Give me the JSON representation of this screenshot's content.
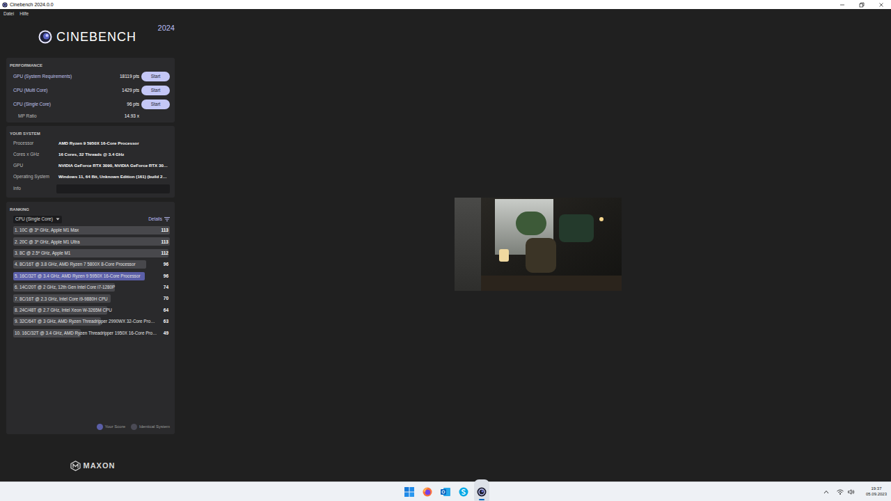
{
  "window": {
    "title": "Cinebench 2024.0.0"
  },
  "menu": [
    "Datei",
    "Hilfe"
  ],
  "logo": {
    "name": "CINEBENCH",
    "year": "2024"
  },
  "performance": {
    "title": "PERFORMANCE",
    "rows": [
      {
        "label": "GPU (System Requirements)",
        "score": "18119 pts",
        "button": "Start"
      },
      {
        "label": "CPU (Multi Core)",
        "score": "1429 pts",
        "button": "Start"
      },
      {
        "label": "CPU (Single Core)",
        "score": "96 pts",
        "button": "Start"
      }
    ],
    "mp_ratio": {
      "label": "MP Ratio",
      "value": "14.93 x"
    }
  },
  "system": {
    "title": "YOUR SYSTEM",
    "rows": [
      {
        "label": "Processor",
        "value": "AMD Ryzen 9 5950X 16-Core Processor"
      },
      {
        "label": "Cores x GHz",
        "value": "16 Cores, 32 Threads @ 3.4 GHz"
      },
      {
        "label": "GPU",
        "value": "NVIDIA GeForce RTX 3090, NVIDIA GeForce RTX 30…"
      },
      {
        "label": "Operating System",
        "value": "Windows 11, 64 Bit, Unknown Edition (161) (build 2…"
      }
    ],
    "info": {
      "label": "Info",
      "value": ""
    }
  },
  "ranking": {
    "title": "RANKING",
    "dropdown": "CPU (Single Core)",
    "details": "Details",
    "items": [
      {
        "label": "1. 10C @ 3* GHz, Apple M1 Max",
        "score": "113",
        "level": 1.0,
        "selected": false
      },
      {
        "label": "2. 20C @ 3* GHz, Apple M1 Ultra",
        "score": "113",
        "level": 1.0,
        "selected": false
      },
      {
        "label": "3. 8C @ 2.5* GHz, Apple M1",
        "score": "112",
        "level": 0.99,
        "selected": false
      },
      {
        "label": "4. 8C/16T @ 3.8 GHz, AMD Ryzen 7 5800X 8-Core Processor",
        "score": "96",
        "level": 0.85,
        "selected": false
      },
      {
        "label": "5. 16C/32T @ 3.4 GHz, AMD Ryzen 9 5950X 16-Core Processor",
        "score": "96",
        "level": 0.84,
        "selected": true
      },
      {
        "label": "6. 14C/20T @ 2 GHz, 12th Gen Intel Core i7-1280P",
        "score": "74",
        "level": 0.65,
        "selected": false
      },
      {
        "label": "7. 8C/16T @ 2.3 GHz, Intel Core i9-9880H CPU",
        "score": "70",
        "level": 0.62,
        "selected": false
      },
      {
        "label": "8. 24C/48T @ 2.7 GHz, Intel Xeon W-3265M CPU",
        "score": "64",
        "level": 0.6,
        "selected": false
      },
      {
        "label": "9. 32C/64T @ 3 GHz, AMD Ryzen Threadripper 2990WX 32-Core Pro…",
        "score": "63",
        "level": 0.56,
        "selected": false
      },
      {
        "label": "10. 16C/32T @ 3.4 GHz, AMD Ryzen Threadripper 1950X 16-Core Pro…",
        "score": "49",
        "level": 0.43,
        "selected": false
      }
    ],
    "legend": [
      {
        "label": "Your Score",
        "color": "#5b5fa8"
      },
      {
        "label": "Identical System",
        "color": "#4a4a55"
      }
    ]
  },
  "footer": {
    "brand": "MAXON"
  },
  "taskbar": {
    "apps": [
      {
        "kind": "start",
        "selected": false
      },
      {
        "kind": "firefox",
        "selected": false
      },
      {
        "kind": "outlook",
        "selected": false
      },
      {
        "kind": "skype",
        "selected": false
      },
      {
        "kind": "cinebench",
        "selected": true
      }
    ],
    "clock": {
      "time": "19:37",
      "date": "05.09.2023"
    }
  }
}
